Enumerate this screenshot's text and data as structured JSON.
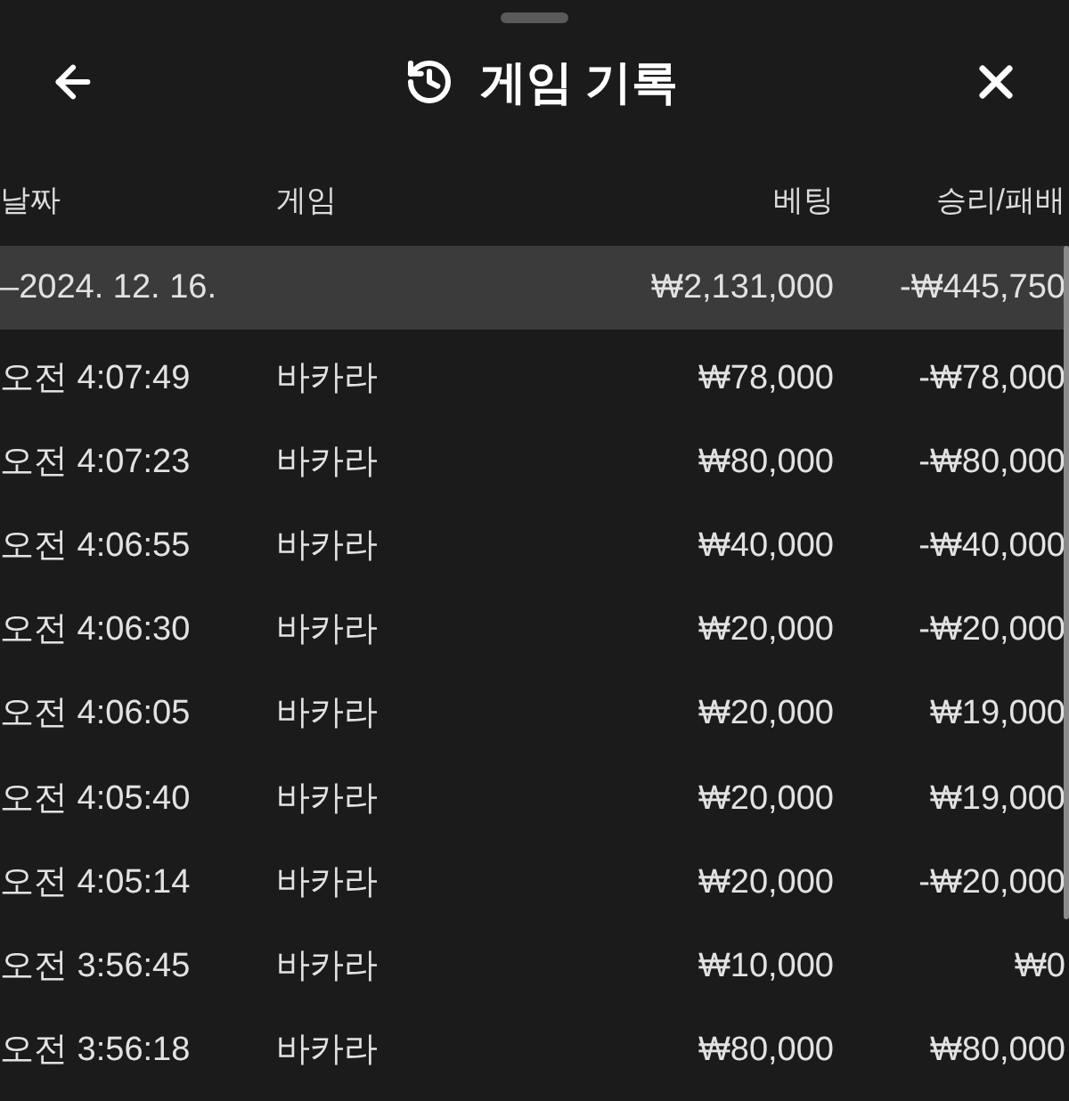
{
  "header": {
    "title": "게임 기록"
  },
  "columns": [
    "날짜",
    "게임",
    "베팅",
    "승리/패배"
  ],
  "group": {
    "date": "–2024. 12. 16.",
    "bet": "₩2,131,000",
    "result": "-₩445,750"
  },
  "rows": [
    {
      "time": "오전 4:07:49",
      "game": "바카라",
      "bet": "₩78,000",
      "result": "-₩78,000"
    },
    {
      "time": "오전 4:07:23",
      "game": "바카라",
      "bet": "₩80,000",
      "result": "-₩80,000"
    },
    {
      "time": "오전 4:06:55",
      "game": "바카라",
      "bet": "₩40,000",
      "result": "-₩40,000"
    },
    {
      "time": "오전 4:06:30",
      "game": "바카라",
      "bet": "₩20,000",
      "result": "-₩20,000"
    },
    {
      "time": "오전 4:06:05",
      "game": "바카라",
      "bet": "₩20,000",
      "result": "₩19,000"
    },
    {
      "time": "오전 4:05:40",
      "game": "바카라",
      "bet": "₩20,000",
      "result": "₩19,000"
    },
    {
      "time": "오전 4:05:14",
      "game": "바카라",
      "bet": "₩20,000",
      "result": "-₩20,000"
    },
    {
      "time": "오전 3:56:45",
      "game": "바카라",
      "bet": "₩10,000",
      "result": "₩0"
    },
    {
      "time": "오전 3:56:18",
      "game": "바카라",
      "bet": "₩80,000",
      "result": "₩80,000"
    }
  ]
}
